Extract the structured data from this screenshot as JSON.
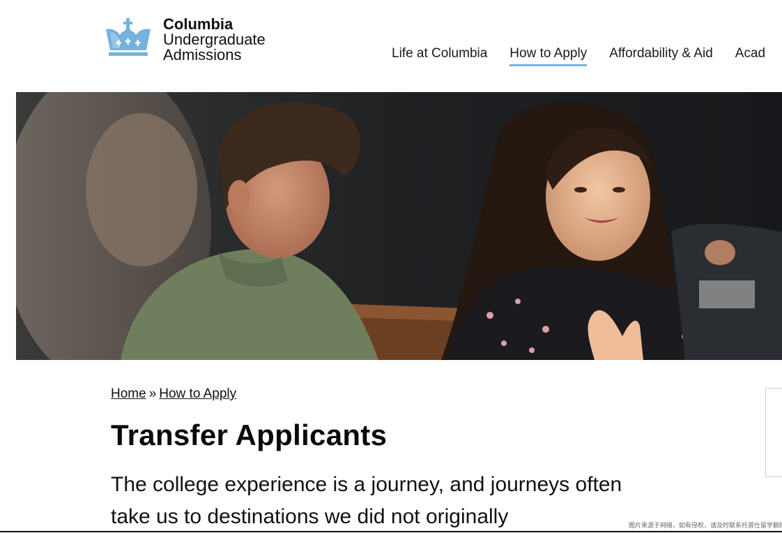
{
  "brand": {
    "line1": "Columbia",
    "line2": "Undergraduate",
    "line3": "Admissions",
    "accent_color": "#75b2dd"
  },
  "nav": {
    "items": [
      {
        "label": "Life at Columbia",
        "active": false
      },
      {
        "label": "How to Apply",
        "active": true
      },
      {
        "label": "Affordability & Aid",
        "active": false
      },
      {
        "label": "Acad",
        "active": false
      }
    ]
  },
  "hero": {
    "image": "students-in-discussion-photo"
  },
  "breadcrumb": {
    "home": "Home",
    "separator": "»",
    "current": "How to Apply"
  },
  "page": {
    "title": "Transfer Applicants",
    "intro": "The college experience is a journey, and journeys often take us to destinations we did not originally"
  },
  "watermark": "图片来源于网络，如有侵权，请及时联系托普仕留学删除"
}
